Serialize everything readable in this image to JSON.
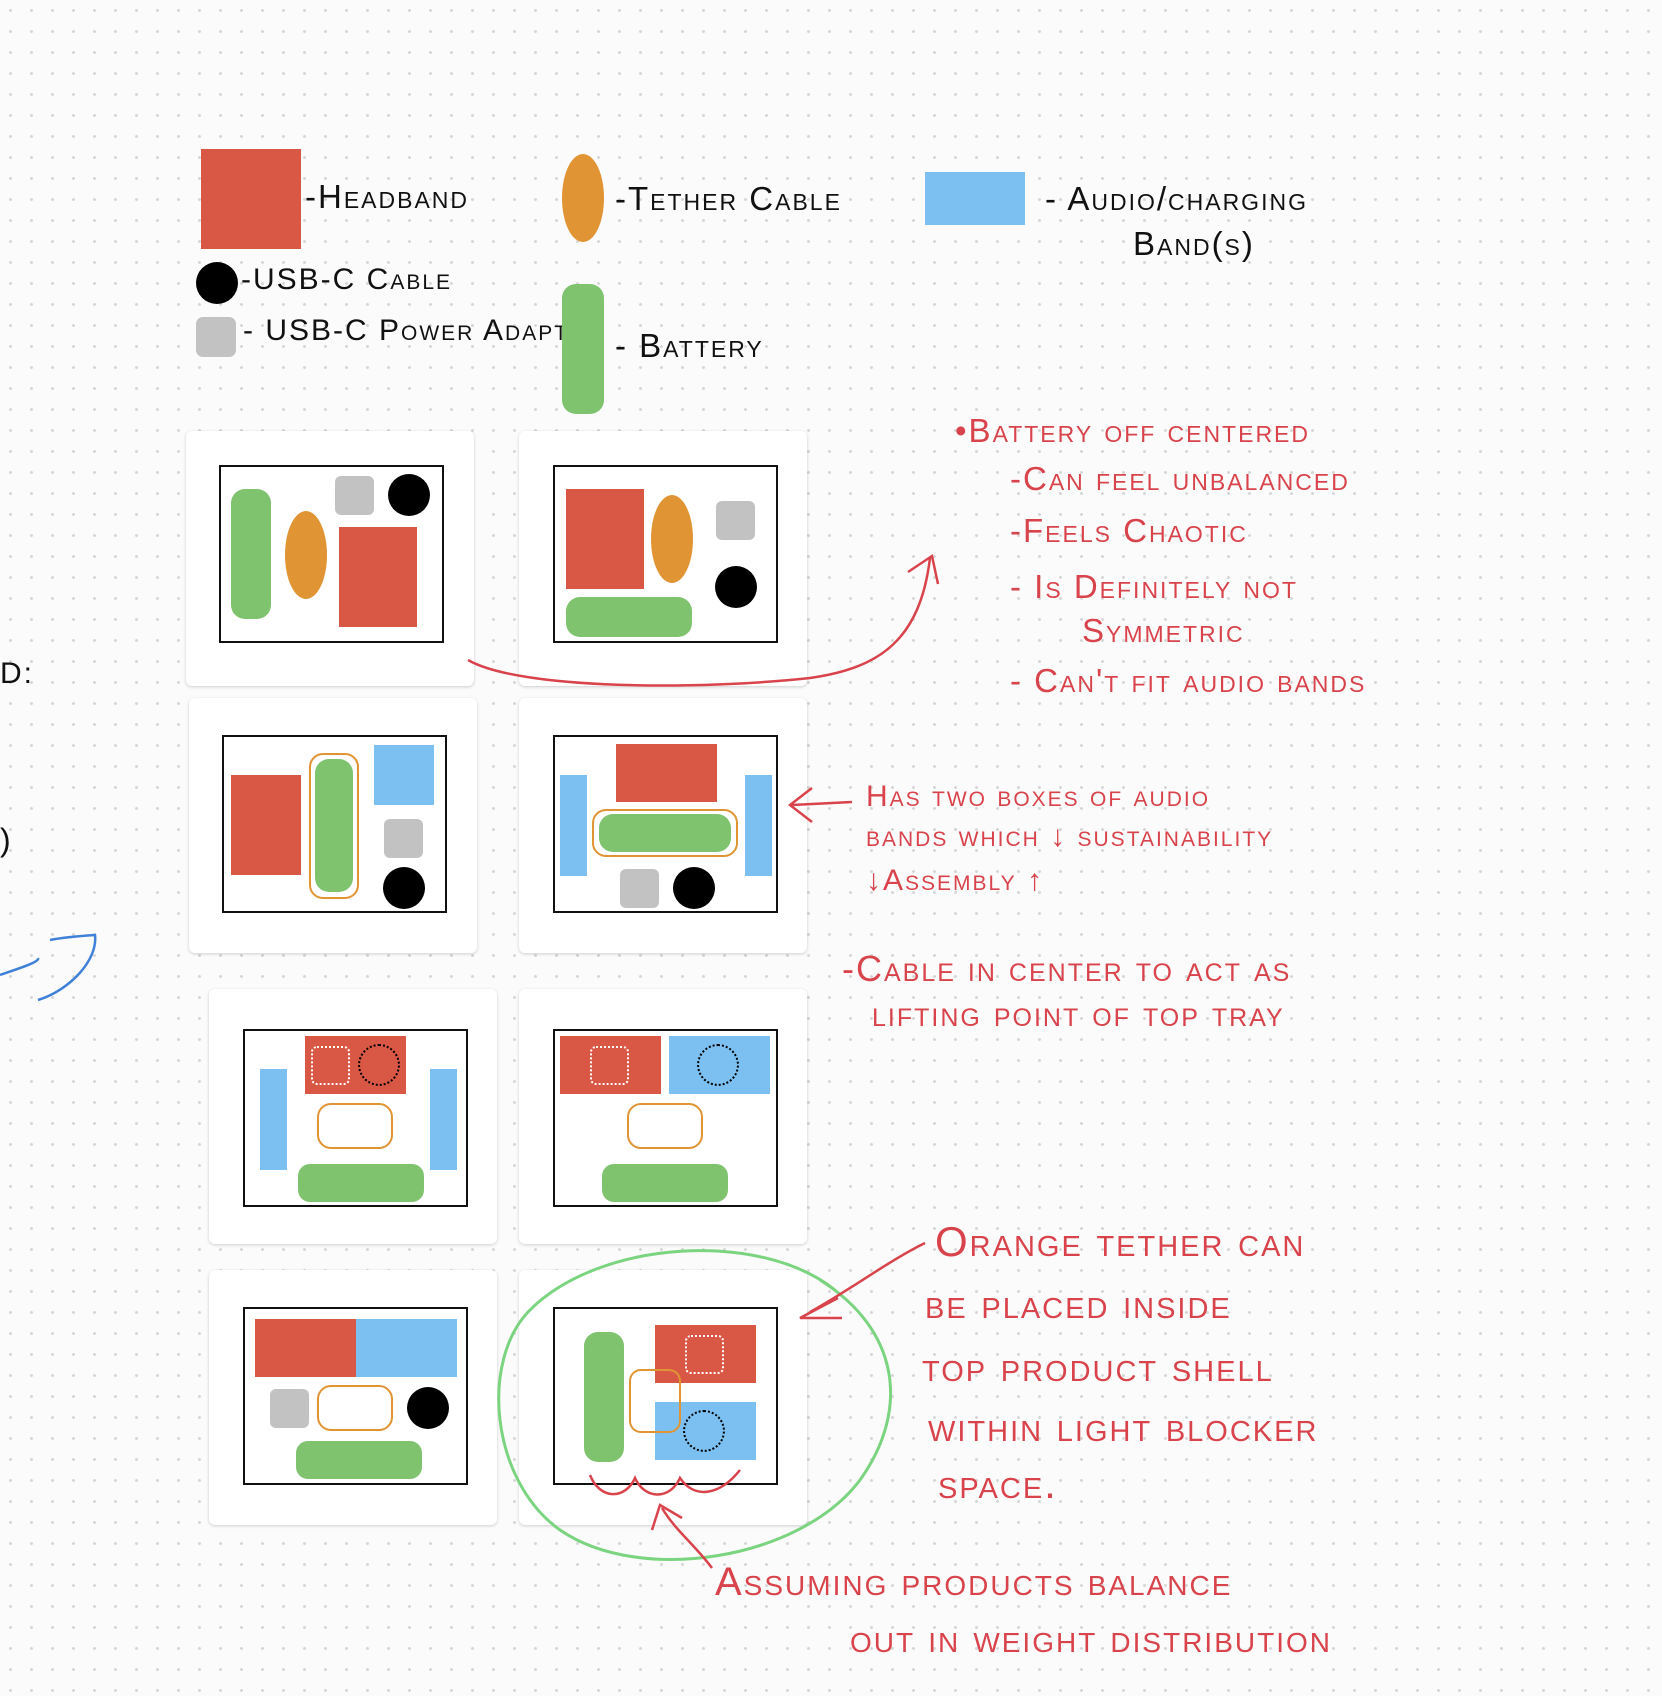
{
  "legend": {
    "headband": "-Headband",
    "usbc_cable": "-USB-C Cable",
    "usbc_adapter": "- USB-C Power Adapter",
    "tether_cable": "-Tether Cable",
    "battery": "- Battery",
    "audio_band_line1": "- Audio/charging",
    "audio_band_line2": "Band(s)"
  },
  "colors": {
    "headband": "#d95745",
    "tether": "#e09433",
    "audio": "#7cc0f1",
    "battery": "#7fc36f",
    "cable": "#000000",
    "adapter": "#c2c2c2",
    "note": "#d9434b",
    "circle": "#7bd47f",
    "blue_stroke": "#3f80d8"
  },
  "left_fragments": {
    "frag1": "D:",
    "frag2": ")"
  },
  "notes": {
    "note1": {
      "line1": "•Battery off centered",
      "line2": "-Can feel unbalanced",
      "line3": "-Feels Chaotic",
      "line4": "- Is Definitely not",
      "line5": "Symmetric",
      "line6": "- Can't fit audio bands"
    },
    "note2": {
      "line1": "Has two boxes of audio",
      "line2": "bands which ↓ sustainability",
      "line3": "↓Assembly ↑"
    },
    "note3": {
      "line1": "-Cable in center to act as",
      "line2": "lifting point of top tray"
    },
    "note4": {
      "line1": "Orange tether can",
      "line2": "be placed inside",
      "line3": "top product shell",
      "line4": "within light blocker",
      "line5": "space."
    },
    "note5": {
      "line1": "Assuming products balance",
      "line2": "out in weight distribution"
    }
  }
}
